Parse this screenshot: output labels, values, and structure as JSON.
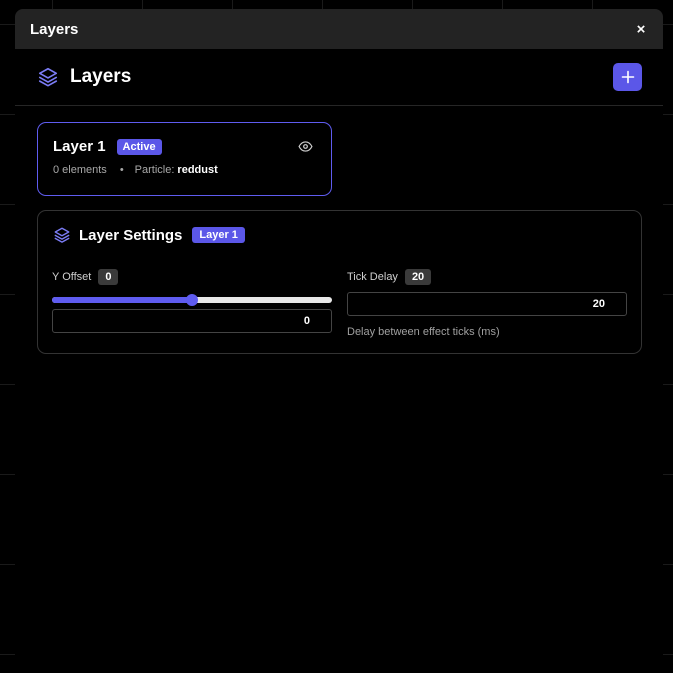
{
  "window": {
    "title": "Layers",
    "close_glyph": "×"
  },
  "panel": {
    "title": "Layers",
    "add_glyph": "+"
  },
  "layer": {
    "name": "Layer 1",
    "status": "Active",
    "elements": "0 elements",
    "separator": "•",
    "particle_label": "Particle:",
    "particle_value": "reddust"
  },
  "settings": {
    "title": "Layer Settings",
    "layer_badge": "Layer 1",
    "y_offset": {
      "label": "Y Offset",
      "badge": "0",
      "input_value": "0",
      "slider_fraction": 0.5
    },
    "tick_delay": {
      "label": "Tick Delay",
      "badge": "20",
      "input_value": "20",
      "hint": "Delay between effect ticks (ms)"
    }
  },
  "colors": {
    "accent": "#5b57e8",
    "background": "#000000",
    "titlebar": "#232323"
  },
  "icons": {
    "layers": "layers-icon",
    "eye": "eye-icon",
    "close": "close-icon",
    "add": "plus-icon"
  }
}
